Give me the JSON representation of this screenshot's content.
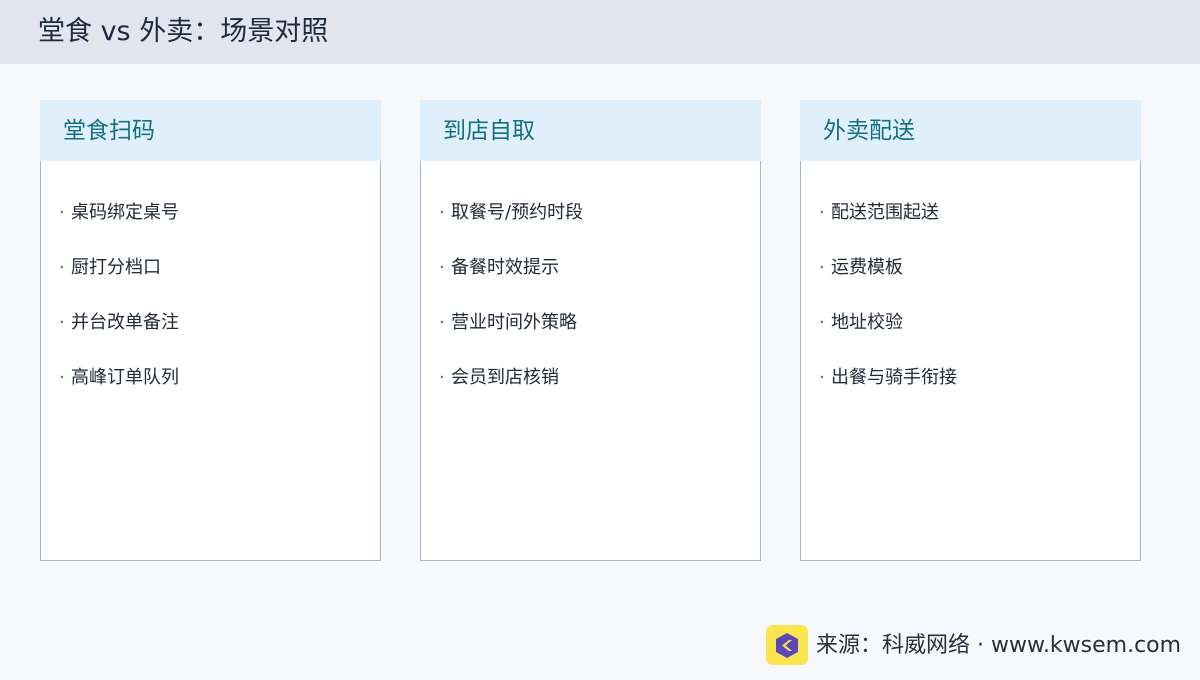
{
  "header": {
    "title": "堂食 vs 外卖：场景对照"
  },
  "cards": [
    {
      "title": "堂食扫码",
      "items": [
        "桌码绑定桌号",
        "厨打分档口",
        "并台改单备注",
        "高峰订单队列"
      ]
    },
    {
      "title": "到店自取",
      "items": [
        "取餐号/预约时段",
        "备餐时效提示",
        "营业时间外策略",
        "会员到店核销"
      ]
    },
    {
      "title": "外卖配送",
      "items": [
        "配送范围起送",
        "运费模板",
        "地址校验",
        "出餐与骑手衔接"
      ]
    }
  ],
  "bullet": "·",
  "footer": {
    "logo_icon": "hexagon-k-logo-icon",
    "source": "来源：科威网络 · www.kwsem.com"
  },
  "colors": {
    "header_bg": "#e1e6ee",
    "card_head_bg": "#dff0fc",
    "card_title": "#147080",
    "logo_bg": "#fae54f",
    "logo_mark": "#5a48b8"
  }
}
